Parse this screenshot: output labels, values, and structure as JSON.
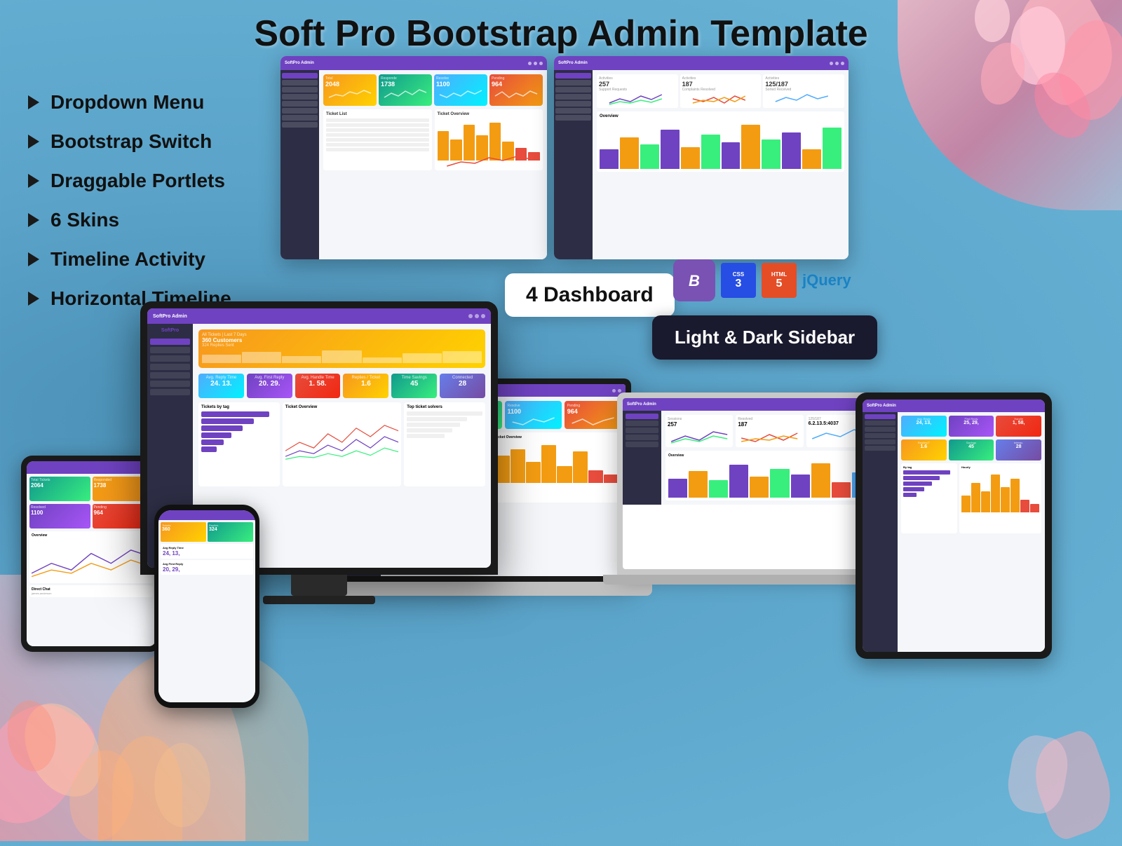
{
  "page": {
    "title": "Soft Pro Bootstrap Admin Template",
    "background_color": "#5ba3c9"
  },
  "features": [
    {
      "id": "dropdown-menu",
      "label": "Dropdown Menu"
    },
    {
      "id": "bootstrap-switch",
      "label": "Bootstrap Switch"
    },
    {
      "id": "draggable-portlets",
      "label": "Draggable Portlets"
    },
    {
      "id": "6-skins",
      "label": "6 Skins"
    },
    {
      "id": "timeline-activity",
      "label": "Timeline Activity"
    },
    {
      "id": "horizontal-timeline",
      "label": "Horizontal Timeline"
    }
  ],
  "badges": {
    "dashboard_count": "4 Dashboard",
    "sidebar_modes": "Light & Dark Sidebar"
  },
  "tech": {
    "css3": "CSS3",
    "html5": "HTML5",
    "jquery": "jQuery",
    "bootstrap": "B"
  },
  "dashboard": {
    "stats": [
      {
        "label": "Total",
        "value": "2048",
        "color": "#f7971e"
      },
      {
        "label": "Responded",
        "value": "1738",
        "color": "#11998e"
      },
      {
        "label": "Resolve",
        "value": "1100",
        "color": "#4facfe"
      },
      {
        "label": "Pending",
        "value": "964",
        "color": "#e74c3c"
      }
    ]
  }
}
